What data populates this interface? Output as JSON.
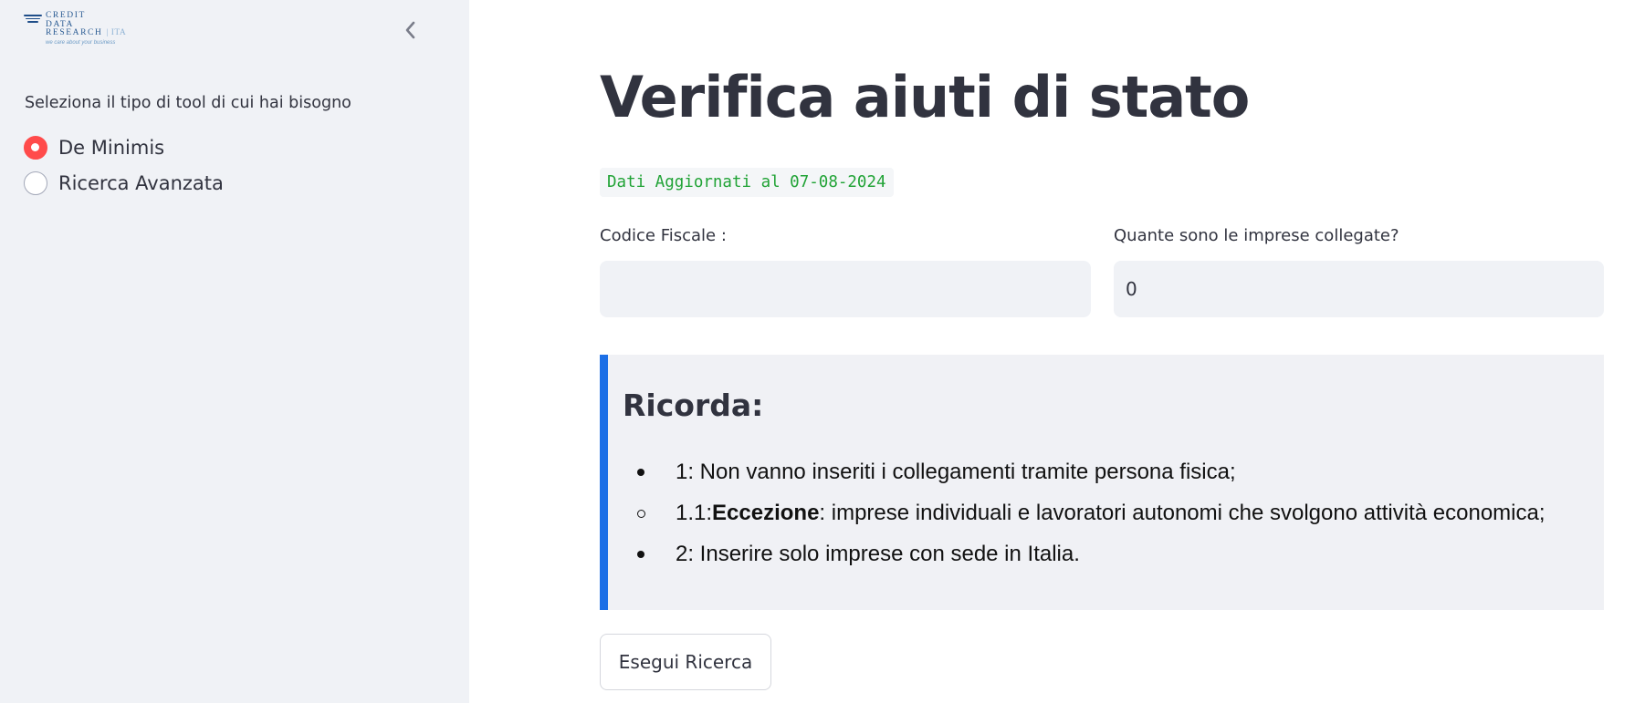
{
  "sidebar": {
    "logo": {
      "line1": "CREDIT",
      "line2": "DATA",
      "line3": "RESEARCH",
      "suffix": "ITA",
      "tagline": "we care about your business"
    },
    "collapse_icon": "chevron-left-icon",
    "label": "Seleziona il tipo di tool di cui hai bisogno",
    "options": [
      {
        "label": "De Minimis",
        "selected": true
      },
      {
        "label": "Ricerca Avanzata",
        "selected": false
      }
    ]
  },
  "main": {
    "title": "Verifica aiuti di stato",
    "update_badge": "Dati Aggiornati al 07-08-2024",
    "fields": {
      "codice_fiscale": {
        "label": "Codice Fiscale :",
        "value": ""
      },
      "imprese": {
        "label": "Quante sono le imprese collegate?",
        "value": "0"
      }
    },
    "info": {
      "title": "Ricorda:",
      "items": [
        {
          "text": "1: Non vanno inseriti i collegamenti tramite persona fisica;"
        },
        {
          "prefix": "1.1: ",
          "bold": "Eccezione",
          "text": ": imprese individuali e lavoratori autonomi che svolgono attività economica;"
        },
        {
          "text": "2: Inserire solo imprese con sede in Italia."
        }
      ]
    },
    "search_button": "Esegui Ricerca"
  },
  "colors": {
    "accent": "#ff4b4b",
    "info_border": "#1c6fe6",
    "badge_text": "#21a336",
    "sidebar_bg": "#f0f2f6"
  }
}
